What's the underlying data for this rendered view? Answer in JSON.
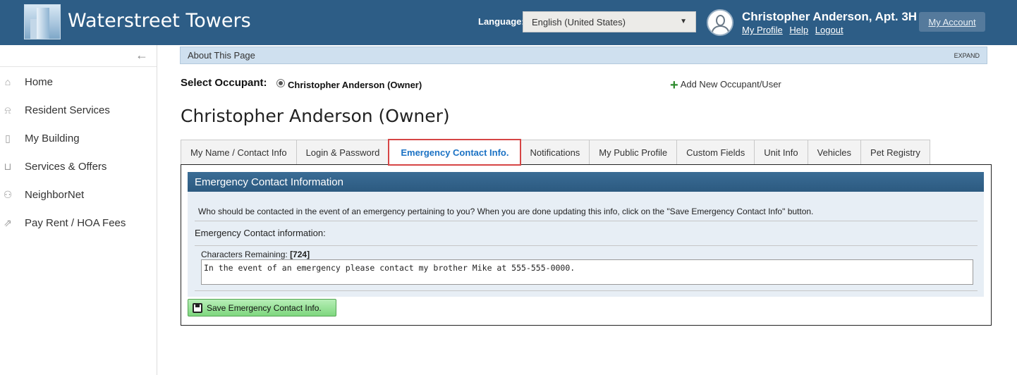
{
  "header": {
    "site_title": "Waterstreet Towers",
    "language_label": "Language:",
    "language_value": "English (United States)",
    "user_name": "Christopher Anderson, Apt. 3H",
    "links": [
      "My Profile",
      "Help",
      "Logout"
    ],
    "my_account": "My Account",
    "brand_color": "#2d5d86"
  },
  "sidebar": {
    "collapse_icon": "arrow-left-icon",
    "items": [
      {
        "label": "Home",
        "icon": "home-icon"
      },
      {
        "label": "Resident Services",
        "icon": "bell-icon"
      },
      {
        "label": "My Building",
        "icon": "building-icon"
      },
      {
        "label": "Services & Offers",
        "icon": "basket-icon"
      },
      {
        "label": "NeighborNet",
        "icon": "people-icon"
      },
      {
        "label": "Pay Rent / HOA Fees",
        "icon": "share-icon"
      }
    ]
  },
  "about": {
    "title": "About This Page",
    "expand": "EXPAND"
  },
  "occupant": {
    "label": "Select Occupant:",
    "selected": "Christopher Anderson (Owner)",
    "add_new": "Add New Occupant/User"
  },
  "page_title": "Christopher Anderson (Owner)",
  "tabs": [
    {
      "label": "My Name / Contact Info",
      "active": false
    },
    {
      "label": "Login & Password",
      "active": false
    },
    {
      "label": "Emergency Contact Info.",
      "active": true
    },
    {
      "label": "Notifications",
      "active": false
    },
    {
      "label": "My Public Profile",
      "active": false
    },
    {
      "label": "Custom Fields",
      "active": false
    },
    {
      "label": "Unit Info",
      "active": false
    },
    {
      "label": "Vehicles",
      "active": false
    },
    {
      "label": "Pet Registry",
      "active": false
    }
  ],
  "emergency": {
    "section_title": "Emergency Contact Information",
    "description": "Who should be contacted in the event of an emergency pertaining to you? When you are done updating this info, click on the \"Save Emergency Contact Info\" button.",
    "field_label": "Emergency Contact information:",
    "chars_label": "Characters Remaining: ",
    "chars_remaining": "[724]",
    "value": "In the event of an emergency please contact my brother Mike at 555-555-0000.",
    "save_label": "Save Emergency Contact Info."
  }
}
